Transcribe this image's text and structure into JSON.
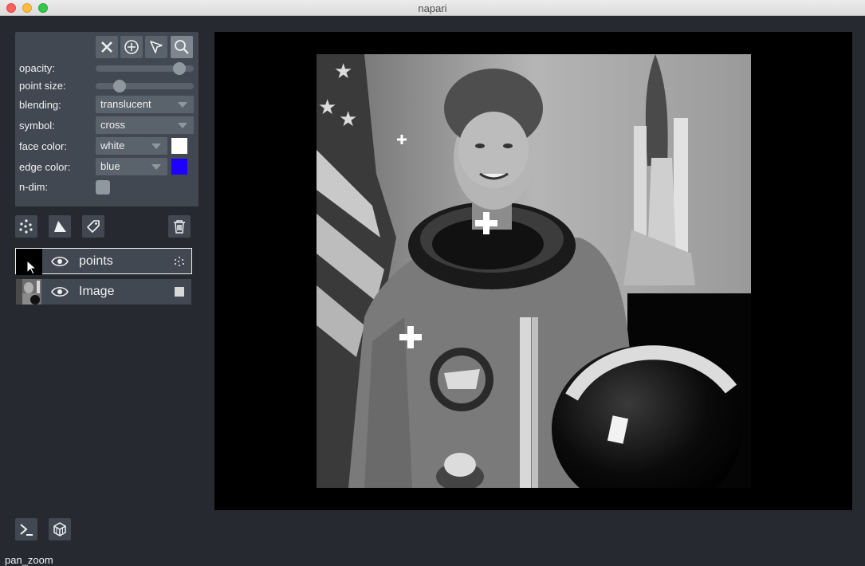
{
  "window": {
    "title": "napari"
  },
  "controls": {
    "opacity_label": "opacity:",
    "opacity_value": 0.85,
    "point_size_label": "point size:",
    "point_size_value": 0.24,
    "blending_label": "blending:",
    "blending_value": "translucent",
    "symbol_label": "symbol:",
    "symbol_value": "cross",
    "face_color_label": "face color:",
    "face_color_value": "white",
    "face_color_hex": "#ffffff",
    "edge_color_label": "edge color:",
    "edge_color_value": "blue",
    "edge_color_hex": "#1d00ff",
    "ndim_label": "n-dim:"
  },
  "tools": [
    "delete-icon",
    "add-point-icon",
    "select-icon",
    "pan-zoom-icon"
  ],
  "layer_buttons": [
    "new-points-icon",
    "new-shapes-icon",
    "new-labels-icon",
    "delete-layer-icon"
  ],
  "layers": [
    {
      "name": "points",
      "selected": true,
      "type_icon": "points-icon"
    },
    {
      "name": "Image",
      "selected": false,
      "type_icon": "image-icon"
    }
  ],
  "bottom_buttons": [
    "console-icon",
    "3d-toggle-icon"
  ],
  "status": {
    "mode": "pan_zoom"
  },
  "colors": {
    "background": "#262930",
    "panel": "#414851",
    "button": "#5a626c",
    "text": "#f0f1f2"
  }
}
